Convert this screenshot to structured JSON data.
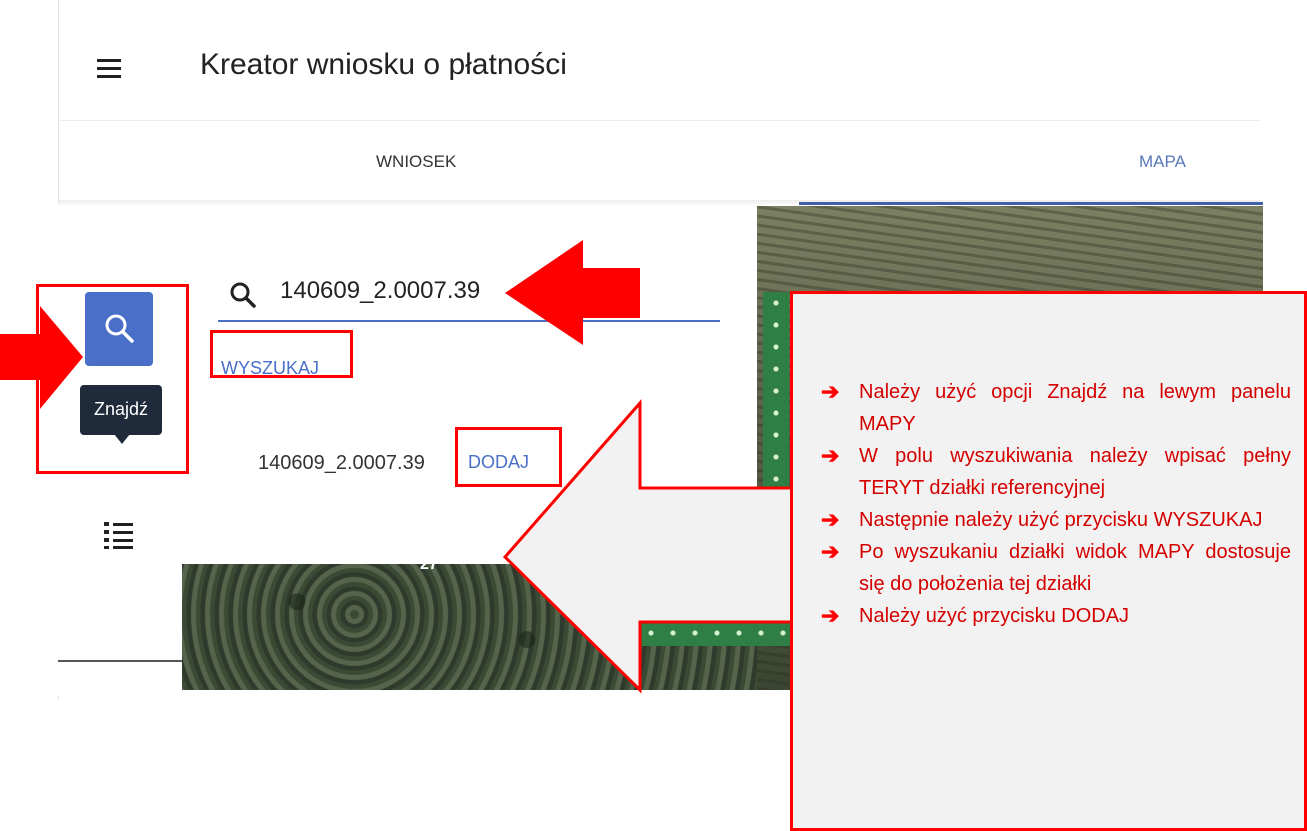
{
  "header": {
    "title": "Kreator wniosku o płatności",
    "menu_icon": "menu-icon"
  },
  "tabs": [
    {
      "label": "WNIOSEK",
      "active": false
    },
    {
      "label": "MAPA",
      "active": true
    }
  ],
  "rail": {
    "find_icon": "search-icon",
    "find_tooltip": "Znajdź",
    "list_icon": "list-icon"
  },
  "search": {
    "value": "140609_2.0007.39",
    "button_label": "WYSZUKAJ"
  },
  "result": {
    "teryt": "140609_2.0007.39",
    "add_label": "DODAJ"
  },
  "map": {
    "label": "27"
  },
  "callout": {
    "bullet_symbol": "➔",
    "items": [
      "Należy użyć opcji Znajdź na lewym panelu MAPY",
      "W polu wyszukiwania należy wpisać pełny TERYT działki referencyjnej",
      "Następnie należy użyć przycisku WYSZUKAJ",
      "Po wyszukaniu działki widok MAPY dostosuje się do położenia tej działki",
      "Należy użyć przycisku DODAJ"
    ]
  },
  "colors": {
    "accent": "#4a6fc8",
    "annotation_red": "#ff0000",
    "callout_text": "#d40000"
  }
}
